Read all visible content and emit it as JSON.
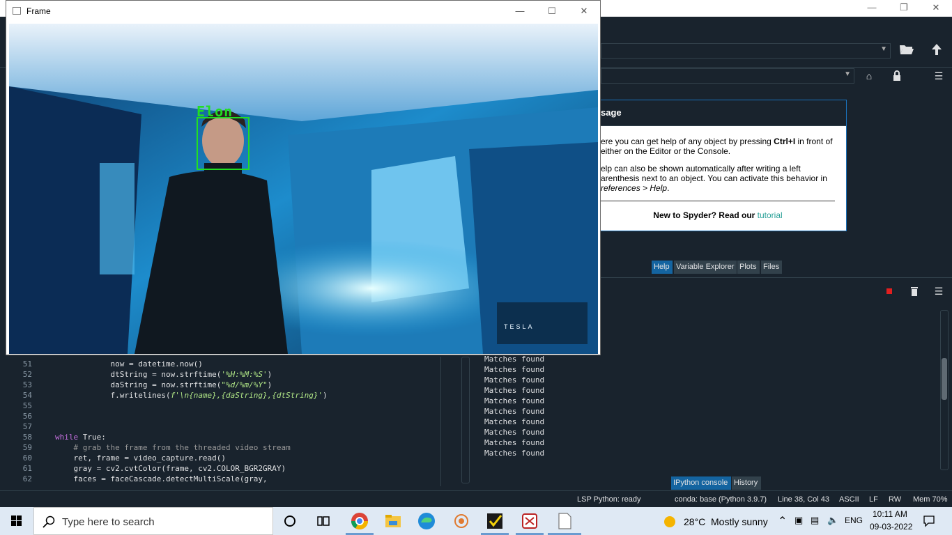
{
  "spyder": {
    "statusbar": {
      "lsp": "LSP Python: ready",
      "conda": "conda: base (Python 3.9.7)",
      "cursor": "Line 38, Col 43",
      "encoding": "ASCII",
      "eol": "LF",
      "perm": "RW",
      "mem": "Mem 70%"
    },
    "help": {
      "header": "sage",
      "p1_pre": "ere you can get help of any object by pressing ",
      "p1_bold": "Ctrl+I",
      "p1_post": " in front of",
      "p1_line2": "either on the Editor or the Console.",
      "p2_l1": "elp can also be shown automatically after writing a left",
      "p2_l2": "arenthesis next to an object. You can activate this behavior in",
      "p2_l3": "references > Help",
      "p2_l3_end": ".",
      "new_text": "New to Spyder? Read our ",
      "tutorial": "tutorial"
    },
    "help_tabs": [
      "Help",
      "Variable Explorer",
      "Plots",
      "Files"
    ],
    "console_tabs": [
      "IPython console",
      "History"
    ],
    "console_lines": [
      "Matches found",
      "Matches found",
      "Matches found",
      "Matches found",
      "Matches found",
      "Matches found",
      "Matches found",
      "Matches found",
      "Matches found",
      "Matches found"
    ],
    "editor": {
      "line_numbers": [
        "51",
        "52",
        "53",
        "54",
        "55",
        "56",
        "57",
        "58",
        "59",
        "60",
        "61",
        "62"
      ],
      "l51": "            now = datetime.now()",
      "l52_pre": "            dtString = now.strftime(",
      "l52_str": "'%H:%M:%S'",
      "l52_post": ")",
      "l53_pre": "            daString = now.strftime(",
      "l53_str": "\"%d/%m/%Y\"",
      "l53_post": ")",
      "l54_pre": "            f.writelines(",
      "l54_str": "f'\\n{name},{daString},{dtString}'",
      "l54_post": ")",
      "l58_kw": "while",
      "l58_rest": " True:",
      "l59": "    # grab the frame from the threaded video stream",
      "l60": "    ret, frame = video_capture.read()",
      "l61": "    gray = cv2.cvtColor(frame, cv2.COLOR_BGR2GRAY)",
      "l62": "    faces = faceCascade.detectMultiScale(gray,"
    }
  },
  "frame_window": {
    "title": "Frame",
    "detected_name": "Elon",
    "watermark": "TESLA"
  },
  "taskbar": {
    "search_placeholder": "Type here to search",
    "weather_temp": "28°C",
    "weather_desc": "Mostly sunny",
    "language": "ENG",
    "time": "10:11 AM",
    "date": "09-03-2022"
  },
  "colors": {
    "spyder_bg": "#19232d",
    "active_tab": "#1464a0",
    "face_box": "#22dd22"
  }
}
